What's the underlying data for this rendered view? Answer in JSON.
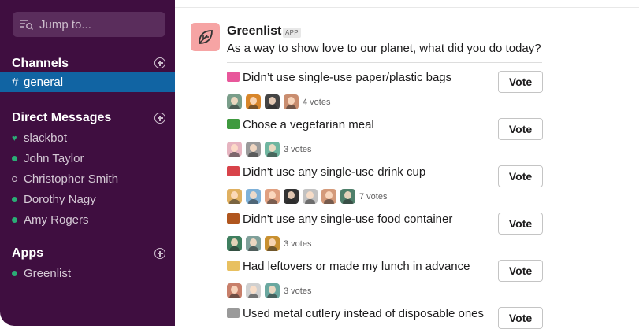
{
  "sidebar": {
    "search_placeholder": "Jump to...",
    "channels_title": "Channels",
    "channels": [
      {
        "label": "general",
        "active": true
      }
    ],
    "dm_title": "Direct Messages",
    "dms": [
      {
        "label": "slackbot",
        "status": "heart"
      },
      {
        "label": "John Taylor",
        "status": "online"
      },
      {
        "label": "Christopher Smith",
        "status": "away"
      },
      {
        "label": "Dorothy Nagy",
        "status": "online"
      },
      {
        "label": "Amy Rogers",
        "status": "online"
      }
    ],
    "apps_title": "Apps",
    "apps": [
      {
        "label": "Greenlist",
        "status": "online"
      }
    ]
  },
  "message": {
    "app_name": "Greenlist",
    "app_badge": "APP",
    "question": "As a way to show love to our planet, what did you do today?",
    "vote_label": "Vote",
    "options": [
      {
        "text": "Didn’t use single-use paper/plastic bags",
        "emoji": "shopping-bag-icon",
        "emoji_color": "#e8579b",
        "votes_text": "4 votes",
        "voter_colors": [
          "#7a9e8a",
          "#d8862a",
          "#444444",
          "#c98d6f"
        ]
      },
      {
        "text": "Chose a vegetarian meal",
        "emoji": "leaf-icon",
        "emoji_color": "#3f9a3f",
        "votes_text": "3 votes",
        "voter_colors": [
          "#e6b4c0",
          "#9a9a9a",
          "#6fb6a0"
        ]
      },
      {
        "text": "Didn't use any single-use drink cup",
        "emoji": "cup-icon",
        "emoji_color": "#d8434a",
        "votes_text": "7 votes",
        "voter_colors": [
          "#e0b060",
          "#7fb1d8",
          "#e0a080",
          "#333333",
          "#c2c2c2",
          "#d49a7a",
          "#4f7f6a"
        ]
      },
      {
        "text": "Didn't use any single-use food container",
        "emoji": "bento-box-icon",
        "emoji_color": "#b0561e",
        "votes_text": "3 votes",
        "voter_colors": [
          "#3f7f5f",
          "#7fa09a",
          "#c89030"
        ]
      },
      {
        "text": "Had leftovers or made my lunch in advance",
        "emoji": "cook-icon",
        "emoji_color": "#e8c060",
        "votes_text": "3 votes",
        "voter_colors": [
          "#c87f6a",
          "#d0d0d0",
          "#6aa8a0"
        ]
      },
      {
        "text": "Used metal cutlery instead of disposable ones",
        "emoji": "fork-knife-icon",
        "emoji_color": "#9a9a9a",
        "votes_text": "",
        "voter_colors": []
      }
    ]
  }
}
